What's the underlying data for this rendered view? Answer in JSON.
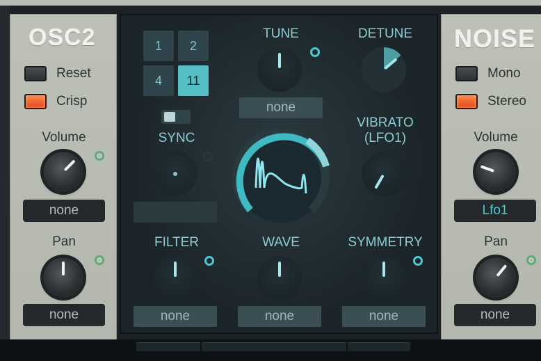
{
  "osc2": {
    "title": "OSC2",
    "reset_label": "Reset",
    "crisp_label": "Crisp",
    "volume_label": "Volume",
    "volume_mod": "none",
    "pan_label": "Pan",
    "pan_mod": "none"
  },
  "noise": {
    "title": "NOISE",
    "mono_label": "Mono",
    "stereo_label": "Stereo",
    "volume_label": "Volume",
    "volume_mod": "Lfo1",
    "pan_label": "Pan",
    "pan_mod": "none"
  },
  "center": {
    "voice_buttons": [
      "1",
      "2",
      "4",
      "11"
    ],
    "selected_voice": "11",
    "tune_label": "TUNE",
    "tune_mod": "none",
    "detune_label": "DETUNE",
    "sync_label": "SYNC",
    "vibrato_label_1": "VIBRATO",
    "vibrato_label_2": "(LFO1)",
    "filter_label": "FILTER",
    "filter_mod": "none",
    "wave_label": "WAVE",
    "wave_mod": "none",
    "symmetry_label": "SYMMETRY",
    "symmetry_mod": "none"
  },
  "colors": {
    "accent": "#4ec8d0",
    "led_on": "#ee5a2a",
    "mod_ring": "#5fa978"
  },
  "icons": [
    "mod-ring-icon",
    "waveform-icon"
  ]
}
